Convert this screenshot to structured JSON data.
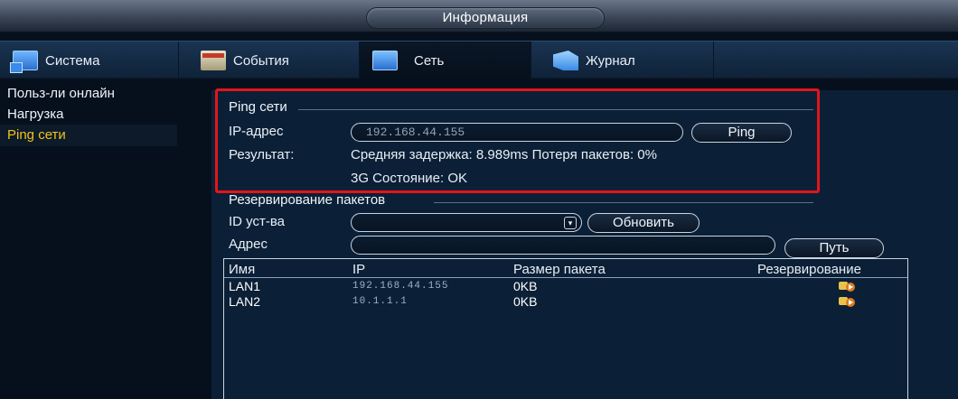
{
  "window": {
    "title": "Информация"
  },
  "tabs": [
    {
      "label": "Система",
      "icon": "system-monitor-icon"
    },
    {
      "label": "События",
      "icon": "events-icon"
    },
    {
      "label": "Сеть",
      "icon": "network-icon",
      "active": true
    },
    {
      "label": "Журнал",
      "icon": "log-icon"
    }
  ],
  "sidebar": {
    "items": [
      {
        "label": "Польз-ли онлайн"
      },
      {
        "label": "Нагрузка"
      },
      {
        "label": "Ping сети",
        "active": true
      }
    ]
  },
  "ping": {
    "section_title": "Ping сети",
    "ip_label": "IP-адрес",
    "ip_value": "192.168.44.155",
    "ping_button": "Ping",
    "result_label": "Результат:",
    "result_text": "Средняя задержка: 8.989ms  Потеря пакетов: 0%",
    "status_text": "3G Состояние: OK"
  },
  "backup": {
    "section_title": "Резервирование пакетов",
    "device_label": "ID уст-ва",
    "device_value": "",
    "refresh_button": "Обновить",
    "address_label": "Адрес",
    "address_value": "",
    "path_button": "Путь",
    "table": {
      "headers": [
        "Имя",
        "IP",
        "Размер пакета",
        "Резервирование"
      ],
      "rows": [
        {
          "name": "LAN1",
          "ip": "192.168.44.155",
          "size": "0KB",
          "action_icon": "backup-icon"
        },
        {
          "name": "LAN2",
          "ip": "10.1.1.1",
          "size": "0KB",
          "action_icon": "backup-icon"
        }
      ]
    }
  },
  "colors": {
    "accent_active": "#f2c418",
    "highlight_border": "#e3151b",
    "panel_bg": "#0b2036"
  }
}
